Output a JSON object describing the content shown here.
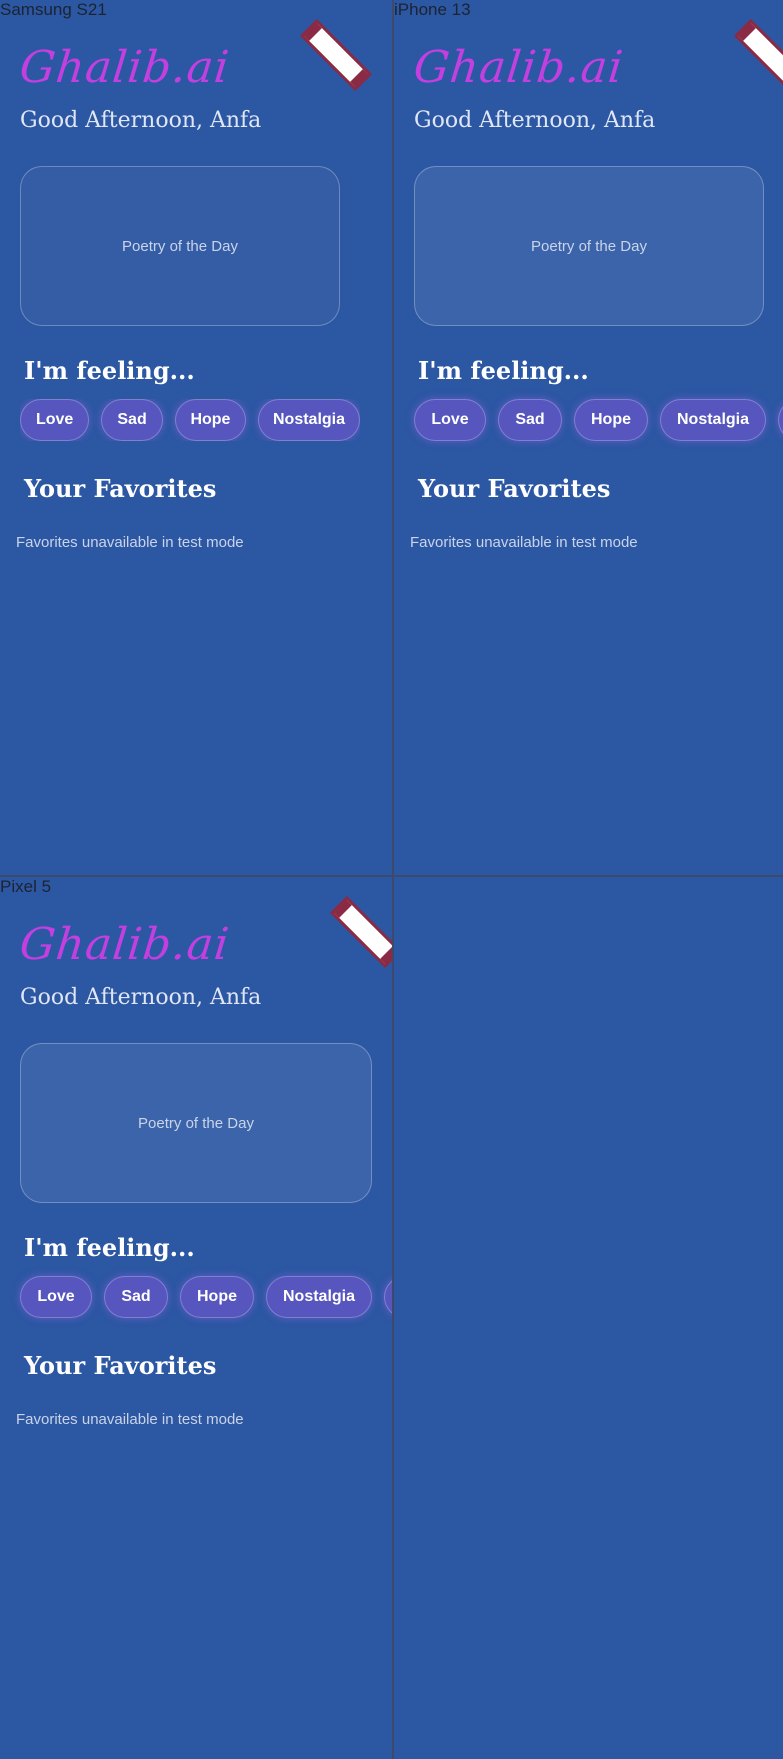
{
  "devices": [
    {
      "label": "Samsung S21"
    },
    {
      "label": "iPhone 13"
    },
    {
      "label": "Pixel 5"
    }
  ],
  "app": {
    "logo": "Ghalib.ai",
    "greeting": "Good Afternoon, Anfa",
    "poetry_card": "Poetry of the Day",
    "feeling_heading": "I'm feeling...",
    "moods": [
      "Love",
      "Sad",
      "Hope",
      "Nostalgia"
    ],
    "favorites_heading": "Your Favorites",
    "favorites_message": "Favorites unavailable in test mode"
  },
  "colors": {
    "background": "#2c57a3",
    "logo": "#c43fe0",
    "chip": "#5656be",
    "banner_edge": "#8a2a45"
  }
}
